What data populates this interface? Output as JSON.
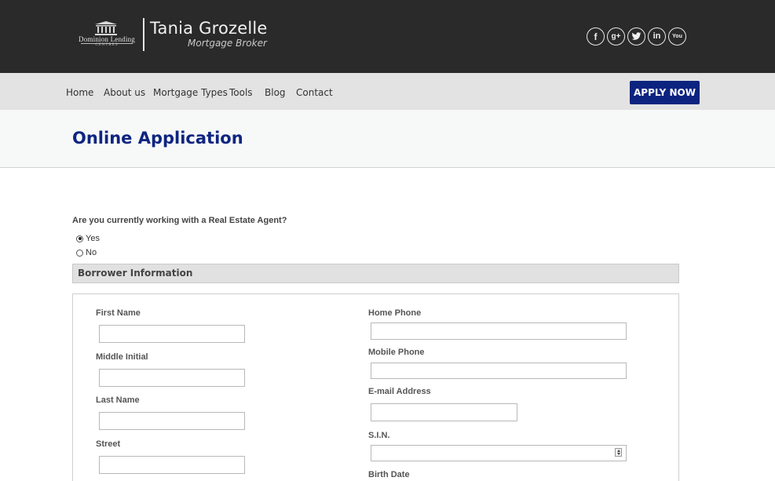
{
  "header": {
    "logo": {
      "brand_line1": "Dominion Lending",
      "brand_line2": "CENTRES"
    },
    "broker_name": "Tania Grozelle",
    "broker_title": "Mortgage Broker",
    "social": [
      {
        "name": "facebook-icon",
        "glyph": "f"
      },
      {
        "name": "google-plus-icon",
        "glyph": "g+"
      },
      {
        "name": "twitter-icon",
        "glyph": "t"
      },
      {
        "name": "linkedin-icon",
        "glyph": "in"
      },
      {
        "name": "youtube-icon",
        "glyph": "You"
      }
    ]
  },
  "nav": {
    "items": [
      "Home",
      "About us",
      "Mortgage Types",
      "Tools",
      "Blog",
      "Contact"
    ],
    "apply_label": "APPLY NOW"
  },
  "page": {
    "title": "Online Application"
  },
  "agent_question": {
    "label": "Are you currently working with a Real Estate Agent?",
    "options": [
      "Yes",
      "No"
    ],
    "selected": "Yes"
  },
  "borrower": {
    "section_title": "Borrower Information",
    "left_fields": [
      "First Name",
      "Middle Initial",
      "Last Name",
      "Street"
    ],
    "right_fields": [
      "Home Phone",
      "Mobile Phone",
      "E-mail Address",
      "S.I.N.",
      "Birth Date"
    ]
  },
  "colors": {
    "header_bg": "#2a2a2a",
    "nav_bg": "#e3e3e3",
    "accent": "#0c2480",
    "title": "#0e2580"
  }
}
